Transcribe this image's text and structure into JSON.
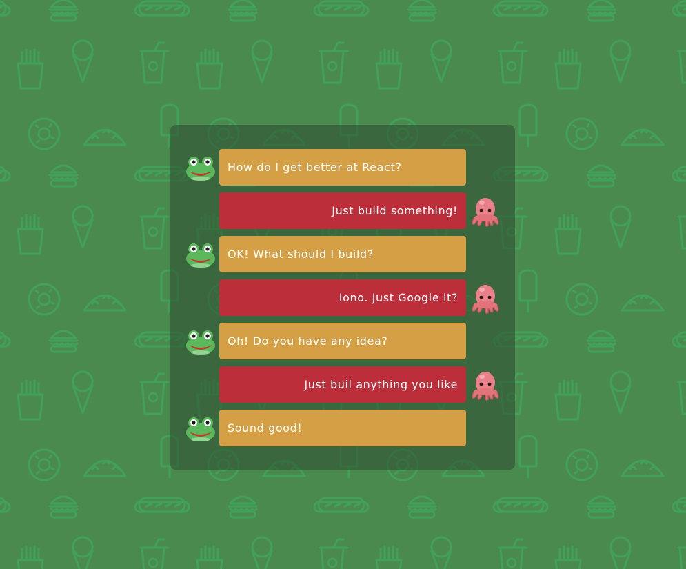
{
  "colors": {
    "background": "#4b8a4f",
    "pattern": "#3fa459",
    "panel": "rgba(45,75,48,0.55)",
    "frog_bubble": "#d49f45",
    "octopus_bubble": "#bb2e3a",
    "text": "#ffffff"
  },
  "messages": [
    {
      "sender": "frog",
      "avatar_icon": "frog-icon",
      "text": "How do I get better at React?"
    },
    {
      "sender": "octopus",
      "avatar_icon": "octopus-icon",
      "text": "Just build something!"
    },
    {
      "sender": "frog",
      "avatar_icon": "frog-icon",
      "text": "OK! What should I build?"
    },
    {
      "sender": "octopus",
      "avatar_icon": "octopus-icon",
      "text": "Iono. Just Google it?"
    },
    {
      "sender": "frog",
      "avatar_icon": "frog-icon",
      "text": "Oh! Do you have any idea?"
    },
    {
      "sender": "octopus",
      "avatar_icon": "octopus-icon",
      "text": "Just buil anything you like"
    },
    {
      "sender": "frog",
      "avatar_icon": "frog-icon",
      "text": "Sound good!"
    }
  ]
}
